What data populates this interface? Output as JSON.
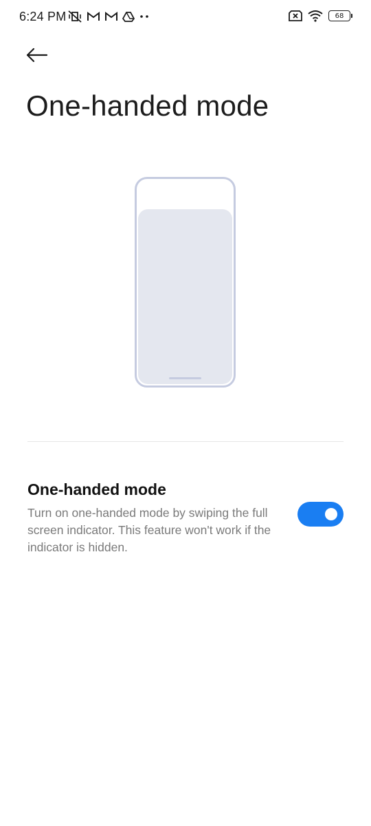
{
  "status_bar": {
    "time": "6:24 PM",
    "left_icons": [
      "vibrate-mute-icon",
      "gmail-icon",
      "gmail-icon",
      "drive-icon",
      "more-dots-icon"
    ],
    "right_icons": [
      "no-sim-icon",
      "wifi-icon",
      "battery-icon"
    ],
    "battery_level": "68"
  },
  "header": {
    "back_icon": "arrow-left-icon",
    "title": "One-handed mode"
  },
  "setting": {
    "title": "One-handed mode",
    "description": "Turn on one-handed mode by swiping the full screen indicator. This feature won't work if the indicator is hidden.",
    "enabled": true,
    "accent_color": "#1a7ef2"
  }
}
